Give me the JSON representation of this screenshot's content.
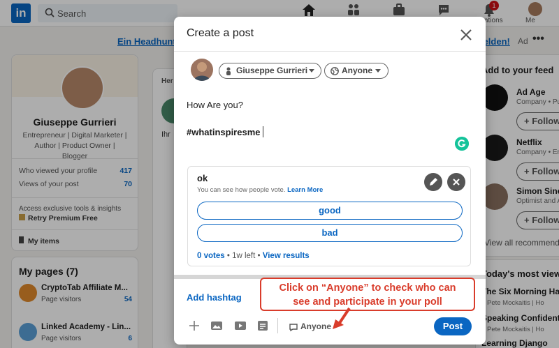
{
  "topbar": {
    "logo": "in",
    "search_placeholder": "Search",
    "notifications_label": "cations",
    "notifications_badge": "1",
    "me_label": "Me"
  },
  "banner": {
    "left_link": "Ein Headhunt",
    "right_link": "melden!",
    "ad_label": "Ad",
    "more": "•••"
  },
  "profile": {
    "name": "Giuseppe Gurrieri",
    "headline": "Entrepreneur | Digital Marketer | Author | Product Owner | Blogger",
    "stats": [
      {
        "label": "Who viewed your profile",
        "value": "417"
      },
      {
        "label": "Views of your post",
        "value": "70"
      }
    ],
    "premium_text": "Access exclusive tools & insights",
    "premium_cta": "Retry Premium Free",
    "my_items": "My items"
  },
  "my_pages": {
    "title": "My pages (7)",
    "items": [
      {
        "name": "CryptoTab Affiliate M...",
        "sub": "Page visitors",
        "count": "54",
        "color": "#e08a2c"
      },
      {
        "name": "Linked Academy - Lin...",
        "sub": "Page visitors",
        "count": "6",
        "color": "#5aa0d8"
      }
    ]
  },
  "feed": {
    "label": "Her",
    "text": "Ihr"
  },
  "right_rail": {
    "title": "Add to your feed",
    "items": [
      {
        "name": "Ad Age",
        "sub": "Company • Pub",
        "follow": "+ Follow",
        "color": "#111111"
      },
      {
        "name": "Netflix",
        "sub": "Company • Ente",
        "follow": "+ Follow",
        "color": "#1a1a1a"
      },
      {
        "name": "Simon Sinek",
        "sub": "Optimist and Au",
        "follow": "+ Follow",
        "color": "#8a7060"
      }
    ],
    "view_all": "View all recommenda"
  },
  "news": {
    "title": "Today's most viewe",
    "items": [
      {
        "title": "The Six Morning Hab",
        "sub": "Pete Mockaitis | Ho"
      },
      {
        "title": "Speaking Confident",
        "sub": "Pete Mockaitis | Ho"
      },
      {
        "title": "Learning Django",
        "sub": ""
      }
    ]
  },
  "modal": {
    "title": "Create a post",
    "author_pill": "Giuseppe Gurrieri",
    "audience_pill": "Anyone",
    "text_line1": "How Are you?",
    "text_line2": "#whatinspiresme",
    "poll": {
      "question": "ok",
      "note": "You can see how people vote.",
      "note_link": "Learn More",
      "options": [
        "good",
        "bad"
      ],
      "votes": "0 votes",
      "time_left": "1w left",
      "view_results": "View results"
    },
    "add_hashtag": "Add hashtag",
    "comment_audience": "Anyone",
    "post_button": "Post"
  },
  "callout": {
    "line1": "Click on “Anyone” to check who can",
    "line2": "see and participate in your poll"
  },
  "colors": {
    "brand_blue": "#0a66c2",
    "callout_red": "#d93c2b",
    "grammarly_green": "#15c39a"
  }
}
